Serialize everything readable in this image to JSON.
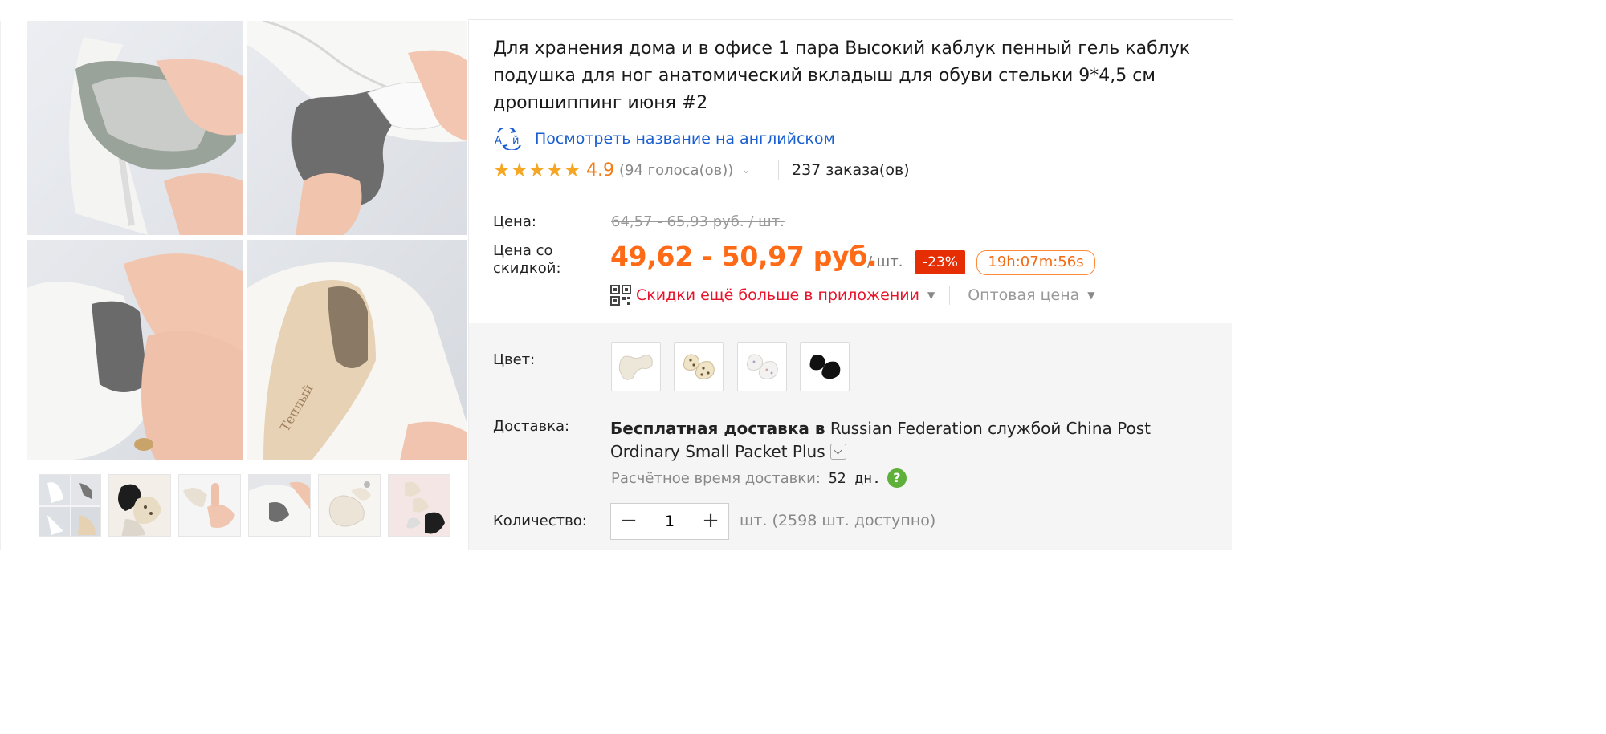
{
  "product": {
    "title": "Для хранения дома и в офисе 1 пара Высокий каблук пенный гель каблук подушка для ног анатомический вкладыш для обуви стельки 9*4,5 см дропшиппинг июня #2",
    "translate_icon": "translate-icon",
    "translate_link": "Посмотреть название на английском",
    "rating": "4.9",
    "votes": "(94 голоса(ов))",
    "orders": "237 заказа(ов)"
  },
  "pricing": {
    "price_label": "Цена:",
    "old_price": "64,57 - 65,93 руб. / шт.",
    "discount_label_1": "Цена со",
    "discount_label_2": "скидкой:",
    "new_price": "49,62 - 50,97 руб.",
    "per_unit": "/ шт.",
    "discount_badge": "-23%",
    "timer": "19h:07m:56s",
    "app_promo": "Скидки ещё больше в приложении",
    "wholesale": "Оптовая цена"
  },
  "options": {
    "color_label": "Цвет:",
    "swatches": [
      "beige-heel-pad",
      "leopard-heel-pad",
      "floral-heel-pad",
      "black-heel-pad"
    ]
  },
  "shipping": {
    "label": "Доставка:",
    "free_text": "Бесплатная доставка в",
    "destination_text": "Russian Federation службой China Post Ordinary Small Packet Plus",
    "eta_label": "Расчётное время доставки:",
    "eta_value": "52 дн.",
    "help_glyph": "?"
  },
  "quantity": {
    "label": "Количество:",
    "minus": "−",
    "value": "1",
    "plus": "+",
    "available": "шт. (2598 шт. доступно)"
  },
  "colors": {
    "accent_orange": "#ff6a16",
    "discount_red": "#e62e04",
    "promo_red": "#e8132a",
    "link_blue": "#1a5fd1",
    "star_gold": "#f5a623"
  }
}
